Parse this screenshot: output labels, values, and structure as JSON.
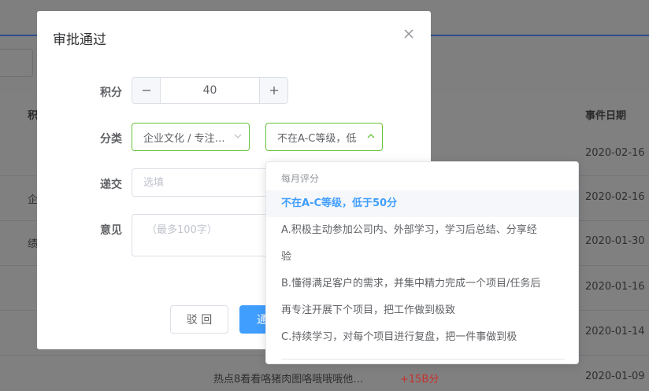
{
  "background": {
    "column_headers": [
      "积",
      "事件日期"
    ],
    "rows": [
      {
        "left": "",
        "date": "2020-02-16"
      },
      {
        "left": "企",
        "date": "2020-02-16"
      },
      {
        "left": "绩",
        "date": "2020-01-30"
      },
      {
        "left": "",
        "date": "2020-01-16"
      },
      {
        "left": "",
        "date": "2020-01-14"
      },
      {
        "left": "",
        "date": "2020-01-09",
        "event": "热点8看看咯猪肉图咯哦哦哦他…",
        "points": "+15B分"
      }
    ]
  },
  "modal": {
    "title": "审批通过",
    "fields": {
      "points_label": "积分",
      "points_value": "40",
      "category_label": "分类",
      "category_value": "企业文化 / 专注…",
      "grade_value": "不在A-C等级，低",
      "submit_label": "递交",
      "submit_placeholder": "选填",
      "comment_label": "意见",
      "comment_placeholder": "（最多100字）"
    },
    "buttons": {
      "reject": "驳 回",
      "approve": "通"
    }
  },
  "dropdown": {
    "group_title": "每月评分",
    "options": [
      "不在A-C等级，低于50分",
      "A.积极主动参加公司内、外部学习，学习后总结、分享经",
      "验",
      "B.懂得满足客户的需求，并集中精力完成一个项目/任务后",
      "再专注开展下个项目，把工作做到极致",
      "C.持续学习，对每个项目进行复盘，把一件事做到极"
    ],
    "selected_index": 0
  },
  "colors": {
    "primary": "#409eff",
    "success_border": "#67c23a",
    "danger_text": "#c9302c"
  }
}
